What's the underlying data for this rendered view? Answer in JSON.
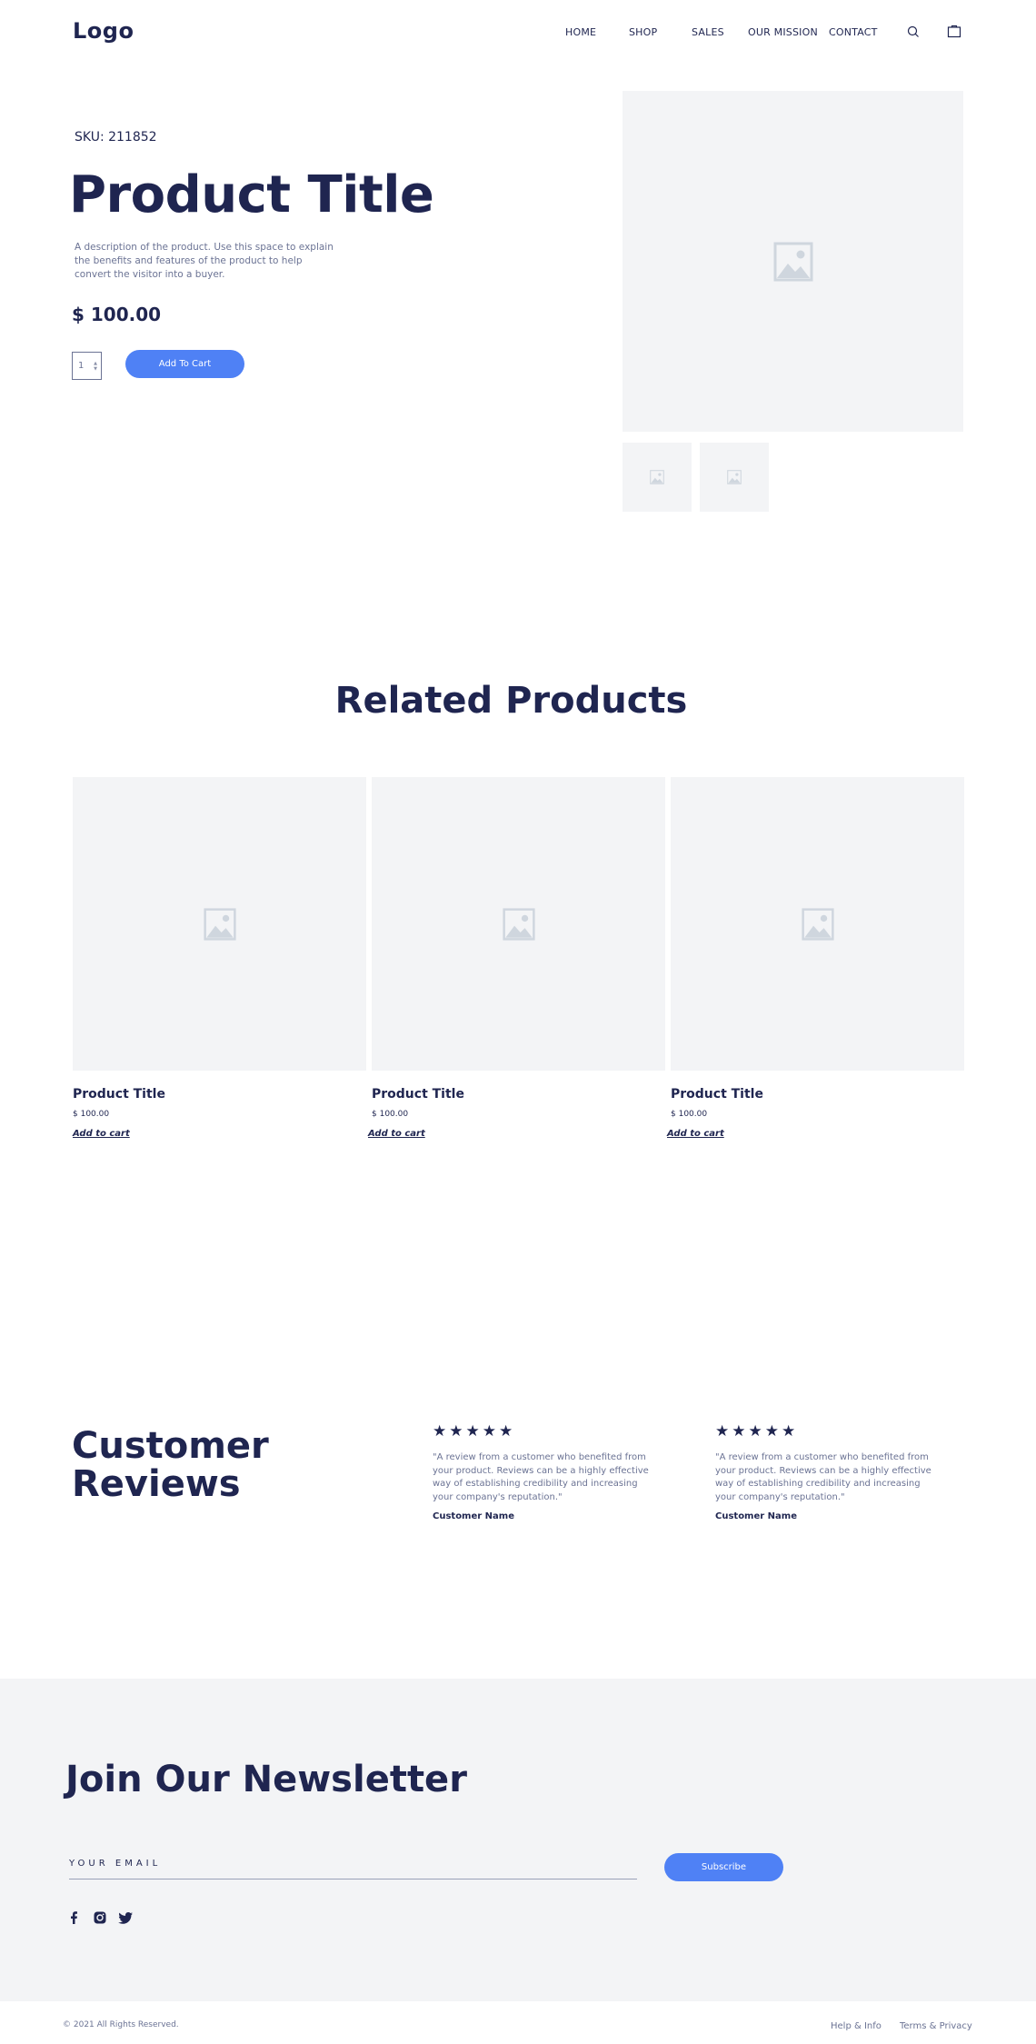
{
  "header": {
    "logo": "Logo",
    "nav": [
      "HOME",
      "SHOP",
      "SALES",
      "OUR MISSION",
      "CONTACT"
    ],
    "icons": [
      "search-icon",
      "shopping-bag-icon"
    ]
  },
  "product": {
    "sku": "SKU: 211852",
    "title": "Product Title",
    "description": "A description of the product. Use this space to explain the benefits and features of the product to help convert the visitor into a buyer.",
    "price": "$ 100.00",
    "quantity": "1",
    "add_to_cart": "Add To Cart"
  },
  "related": {
    "title": "Related Products",
    "items": [
      {
        "title": "Product Title",
        "price": "$ 100.00",
        "link": "Add to cart"
      },
      {
        "title": "Product Title",
        "price": "$ 100.00",
        "link": "Add to cart"
      },
      {
        "title": "Product Title",
        "price": "$ 100.00",
        "link": "Add to cart"
      }
    ]
  },
  "reviews": {
    "title": "Customer Reviews",
    "items": [
      {
        "stars": "★★★★★",
        "text": "\"A review from a customer who benefited from your product. Reviews can be a highly effective way of establishing credibility and increasing your company's reputation.\"",
        "name": "Customer Name"
      },
      {
        "stars": "★★★★★",
        "text": "\"A review from a customer who benefited from your product. Reviews can be a highly effective way of establishing credibility and increasing your company's reputation.\"",
        "name": "Customer Name"
      }
    ]
  },
  "newsletter": {
    "title": "Join Our Newsletter",
    "email_placeholder": "YOUR EMAIL",
    "subscribe": "Subscribe",
    "social_icons": [
      "facebook-icon",
      "instagram-icon",
      "twitter-icon"
    ]
  },
  "footer": {
    "copyright": "© 2021 All Rights Reserved.",
    "links": [
      "Help & Info",
      "Terms & Privacy"
    ]
  },
  "colors": {
    "accent": "#4f81f5",
    "text": "#1f2550",
    "muted": "#6b7394",
    "placeholder_bg": "#f3f4f6",
    "placeholder_icon": "#cfd6de"
  }
}
